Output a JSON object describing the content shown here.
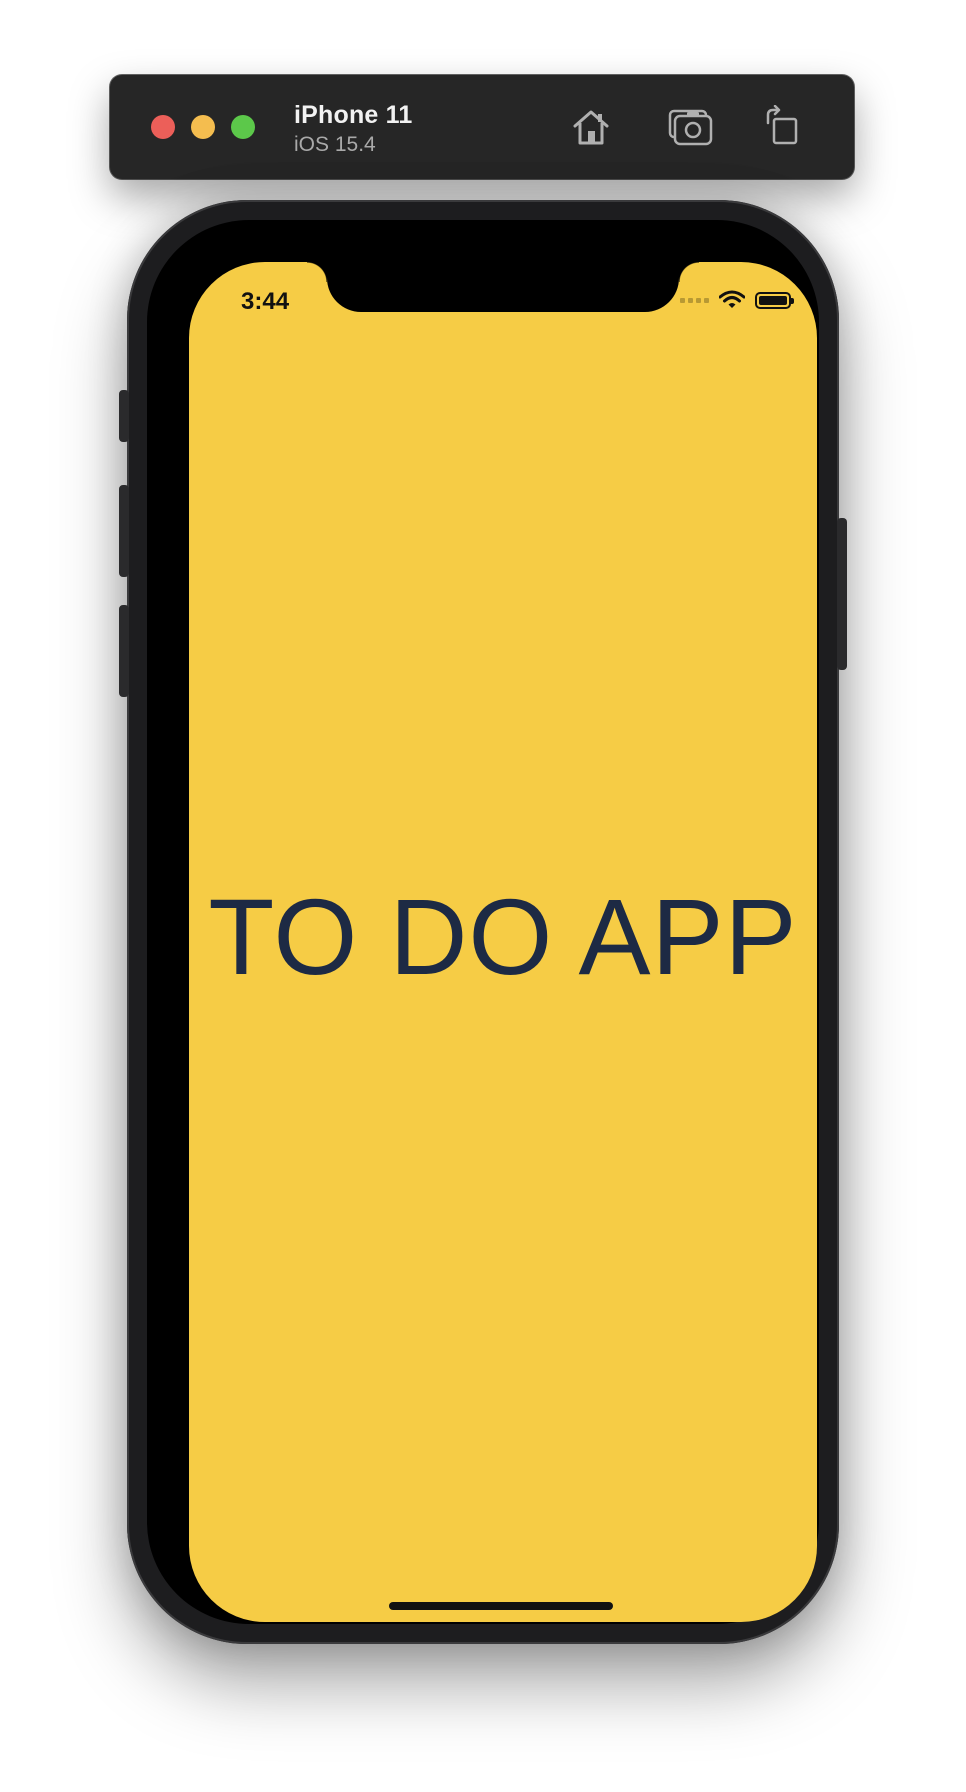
{
  "simulator": {
    "device_name": "iPhone 11",
    "os_version": "iOS 15.4",
    "buttons": {
      "home": "home-icon",
      "screenshot": "camera-icon",
      "rotate": "rotate-icon"
    },
    "traffic_lights": [
      "#ec5f59",
      "#f4bd4f",
      "#5cc84a"
    ]
  },
  "status_bar": {
    "time": "3:44",
    "wifi": "wifi-icon",
    "battery": "battery-full-icon"
  },
  "screen": {
    "background": "#f6cc45",
    "title": "TO DO APP",
    "title_color": "#1d2a44"
  }
}
